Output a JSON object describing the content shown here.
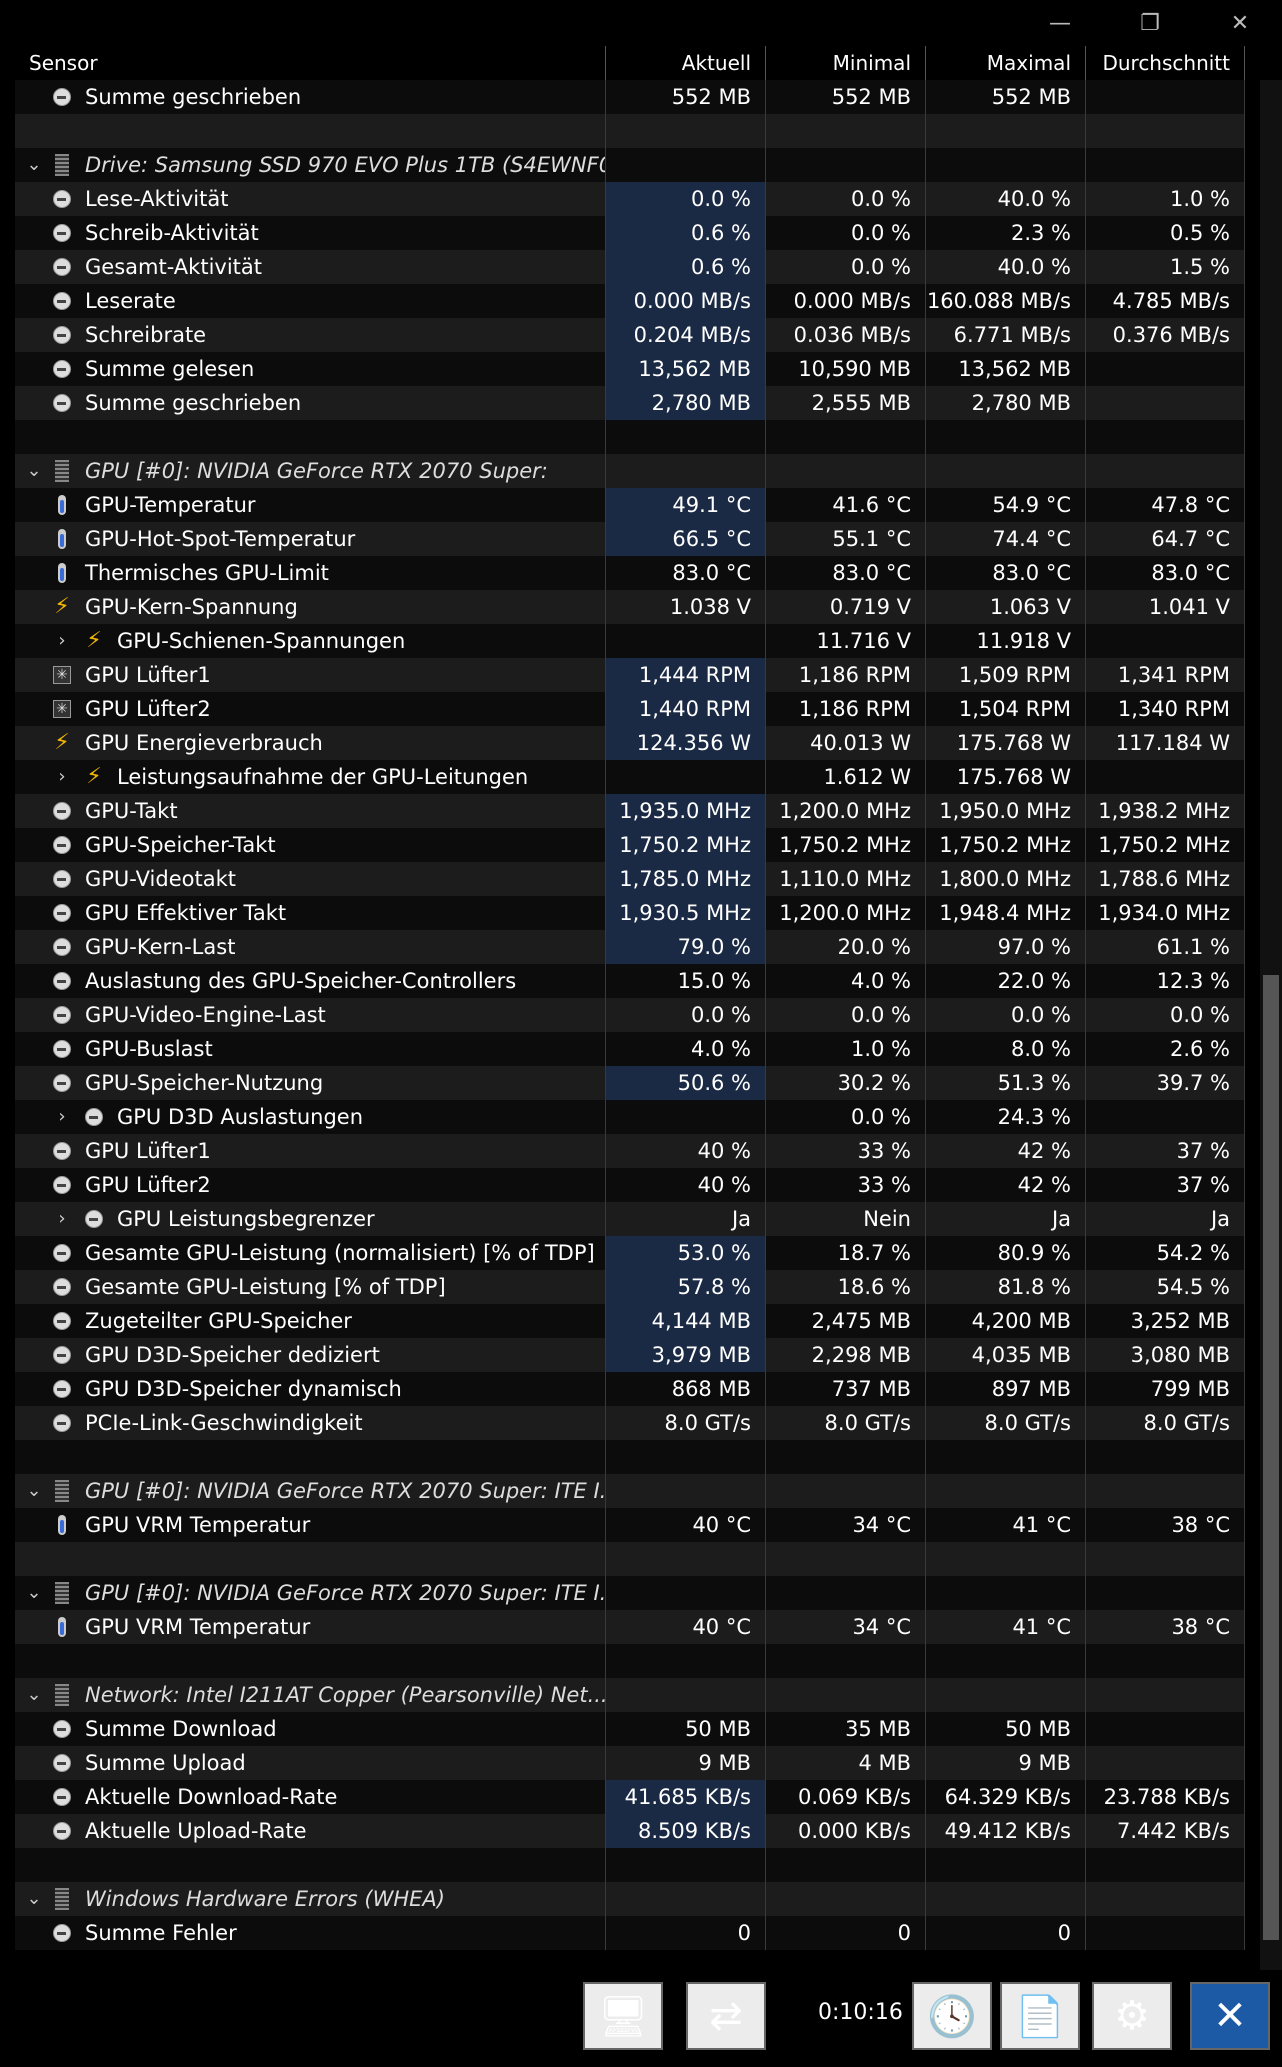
{
  "window": {
    "minimize_glyph": "—",
    "restore_glyph": "❐",
    "close_glyph": "✕"
  },
  "columns": {
    "sensor": "Sensor",
    "current": "Aktuell",
    "min": "Minimal",
    "max": "Maximal",
    "avg": "Durchschnitt"
  },
  "rows": [
    {
      "type": "item",
      "icon": "clock-icon",
      "label": "Summe geschrieben",
      "v": [
        "552 MB",
        "552 MB",
        "552 MB",
        ""
      ],
      "hl": false
    },
    {
      "type": "blank"
    },
    {
      "type": "group",
      "label": "Drive: Samsung SSD 970 EVO Plus 1TB (S4EWNF0..."
    },
    {
      "type": "item",
      "icon": "clock-icon",
      "label": "Lese-Aktivität",
      "v": [
        "0.0 %",
        "0.0 %",
        "40.0 %",
        "1.0 %"
      ],
      "hl": true
    },
    {
      "type": "item",
      "icon": "clock-icon",
      "label": "Schreib-Aktivität",
      "v": [
        "0.6 %",
        "0.0 %",
        "2.3 %",
        "0.5 %"
      ],
      "hl": true
    },
    {
      "type": "item",
      "icon": "clock-icon",
      "label": "Gesamt-Aktivität",
      "v": [
        "0.6 %",
        "0.0 %",
        "40.0 %",
        "1.5 %"
      ],
      "hl": true
    },
    {
      "type": "item",
      "icon": "clock-icon",
      "label": "Leserate",
      "v": [
        "0.000 MB/s",
        "0.000 MB/s",
        "160.088 MB/s",
        "4.785 MB/s"
      ],
      "hl": true
    },
    {
      "type": "item",
      "icon": "clock-icon",
      "label": "Schreibrate",
      "v": [
        "0.204 MB/s",
        "0.036 MB/s",
        "6.771 MB/s",
        "0.376 MB/s"
      ],
      "hl": true
    },
    {
      "type": "item",
      "icon": "clock-icon",
      "label": "Summe gelesen",
      "v": [
        "13,562 MB",
        "10,590 MB",
        "13,562 MB",
        ""
      ],
      "hl": true
    },
    {
      "type": "item",
      "icon": "clock-icon",
      "label": "Summe geschrieben",
      "v": [
        "2,780 MB",
        "2,555 MB",
        "2,780 MB",
        ""
      ],
      "hl": true
    },
    {
      "type": "blank"
    },
    {
      "type": "group",
      "label": "GPU [#0]: NVIDIA GeForce RTX 2070 Super:"
    },
    {
      "type": "item",
      "icon": "thermometer-icon",
      "label": "GPU-Temperatur",
      "v": [
        "49.1 °C",
        "41.6 °C",
        "54.9 °C",
        "47.8 °C"
      ],
      "hl": true
    },
    {
      "type": "item",
      "icon": "thermometer-icon",
      "label": "GPU-Hot-Spot-Temperatur",
      "v": [
        "66.5 °C",
        "55.1 °C",
        "74.4 °C",
        "64.7 °C"
      ],
      "hl": true
    },
    {
      "type": "item",
      "icon": "thermometer-icon",
      "label": "Thermisches GPU-Limit",
      "v": [
        "83.0 °C",
        "83.0 °C",
        "83.0 °C",
        "83.0 °C"
      ],
      "hl": false
    },
    {
      "type": "item",
      "icon": "voltage-icon",
      "label": "GPU-Kern-Spannung",
      "v": [
        "1.038 V",
        "0.719 V",
        "1.063 V",
        "1.041 V"
      ],
      "hl": false
    },
    {
      "type": "item",
      "icon": "voltage-icon",
      "label": "GPU-Schienen-Spannungen",
      "v": [
        "",
        "11.716 V",
        "11.918 V",
        ""
      ],
      "hl": false,
      "sub": true
    },
    {
      "type": "item",
      "icon": "fan-icon",
      "label": "GPU Lüfter1",
      "v": [
        "1,444 RPM",
        "1,186 RPM",
        "1,509 RPM",
        "1,341 RPM"
      ],
      "hl": true
    },
    {
      "type": "item",
      "icon": "fan-icon",
      "label": "GPU Lüfter2",
      "v": [
        "1,440 RPM",
        "1,186 RPM",
        "1,504 RPM",
        "1,340 RPM"
      ],
      "hl": true
    },
    {
      "type": "item",
      "icon": "voltage-icon",
      "label": "GPU Energieverbrauch",
      "v": [
        "124.356 W",
        "40.013 W",
        "175.768 W",
        "117.184 W"
      ],
      "hl": true
    },
    {
      "type": "item",
      "icon": "voltage-icon",
      "label": "Leistungsaufnahme der GPU-Leitungen",
      "v": [
        "",
        "1.612 W",
        "175.768 W",
        ""
      ],
      "hl": false,
      "sub": true
    },
    {
      "type": "item",
      "icon": "clock-icon",
      "label": "GPU-Takt",
      "v": [
        "1,935.0 MHz",
        "1,200.0 MHz",
        "1,950.0 MHz",
        "1,938.2 MHz"
      ],
      "hl": true
    },
    {
      "type": "item",
      "icon": "clock-icon",
      "label": "GPU-Speicher-Takt",
      "v": [
        "1,750.2 MHz",
        "1,750.2 MHz",
        "1,750.2 MHz",
        "1,750.2 MHz"
      ],
      "hl": true
    },
    {
      "type": "item",
      "icon": "clock-icon",
      "label": "GPU-Videotakt",
      "v": [
        "1,785.0 MHz",
        "1,110.0 MHz",
        "1,800.0 MHz",
        "1,788.6 MHz"
      ],
      "hl": true
    },
    {
      "type": "item",
      "icon": "clock-icon",
      "label": "GPU Effektiver Takt",
      "v": [
        "1,930.5 MHz",
        "1,200.0 MHz",
        "1,948.4 MHz",
        "1,934.0 MHz"
      ],
      "hl": true
    },
    {
      "type": "item",
      "icon": "clock-icon",
      "label": "GPU-Kern-Last",
      "v": [
        "79.0 %",
        "20.0 %",
        "97.0 %",
        "61.1 %"
      ],
      "hl": true
    },
    {
      "type": "item",
      "icon": "clock-icon",
      "label": "Auslastung des GPU-Speicher-Controllers",
      "v": [
        "15.0 %",
        "4.0 %",
        "22.0 %",
        "12.3 %"
      ],
      "hl": false
    },
    {
      "type": "item",
      "icon": "clock-icon",
      "label": "GPU-Video-Engine-Last",
      "v": [
        "0.0 %",
        "0.0 %",
        "0.0 %",
        "0.0 %"
      ],
      "hl": false
    },
    {
      "type": "item",
      "icon": "clock-icon",
      "label": "GPU-Buslast",
      "v": [
        "4.0 %",
        "1.0 %",
        "8.0 %",
        "2.6 %"
      ],
      "hl": false
    },
    {
      "type": "item",
      "icon": "clock-icon",
      "label": "GPU-Speicher-Nutzung",
      "v": [
        "50.6 %",
        "30.2 %",
        "51.3 %",
        "39.7 %"
      ],
      "hl": true
    },
    {
      "type": "item",
      "icon": "clock-icon",
      "label": "GPU D3D Auslastungen",
      "v": [
        "",
        "0.0 %",
        "24.3 %",
        ""
      ],
      "hl": false,
      "sub": true
    },
    {
      "type": "item",
      "icon": "clock-icon",
      "label": "GPU Lüfter1",
      "v": [
        "40 %",
        "33 %",
        "42 %",
        "37 %"
      ],
      "hl": false
    },
    {
      "type": "item",
      "icon": "clock-icon",
      "label": "GPU Lüfter2",
      "v": [
        "40 %",
        "33 %",
        "42 %",
        "37 %"
      ],
      "hl": false
    },
    {
      "type": "item",
      "icon": "clock-icon",
      "label": "GPU Leistungsbegrenzer",
      "v": [
        "Ja",
        "Nein",
        "Ja",
        "Ja"
      ],
      "hl": false,
      "sub": true
    },
    {
      "type": "item",
      "icon": "clock-icon",
      "label": "Gesamte GPU-Leistung (normalisiert) [% of TDP]",
      "v": [
        "53.0 %",
        "18.7 %",
        "80.9 %",
        "54.2 %"
      ],
      "hl": true
    },
    {
      "type": "item",
      "icon": "clock-icon",
      "label": "Gesamte GPU-Leistung [% of TDP]",
      "v": [
        "57.8 %",
        "18.6 %",
        "81.8 %",
        "54.5 %"
      ],
      "hl": true
    },
    {
      "type": "item",
      "icon": "clock-icon",
      "label": "Zugeteilter GPU-Speicher",
      "v": [
        "4,144 MB",
        "2,475 MB",
        "4,200 MB",
        "3,252 MB"
      ],
      "hl": true
    },
    {
      "type": "item",
      "icon": "clock-icon",
      "label": "GPU D3D-Speicher dediziert",
      "v": [
        "3,979 MB",
        "2,298 MB",
        "4,035 MB",
        "3,080 MB"
      ],
      "hl": true
    },
    {
      "type": "item",
      "icon": "clock-icon",
      "label": "GPU D3D-Speicher dynamisch",
      "v": [
        "868 MB",
        "737 MB",
        "897 MB",
        "799 MB"
      ],
      "hl": false
    },
    {
      "type": "item",
      "icon": "clock-icon",
      "label": "PCIe-Link-Geschwindigkeit",
      "v": [
        "8.0 GT/s",
        "8.0 GT/s",
        "8.0 GT/s",
        "8.0 GT/s"
      ],
      "hl": false
    },
    {
      "type": "blank"
    },
    {
      "type": "group",
      "label": "GPU [#0]: NVIDIA GeForce RTX 2070 Super: ITE I..."
    },
    {
      "type": "item",
      "icon": "thermometer-icon",
      "label": "GPU VRM Temperatur",
      "v": [
        "40 °C",
        "34 °C",
        "41 °C",
        "38 °C"
      ],
      "hl": false
    },
    {
      "type": "blank"
    },
    {
      "type": "group",
      "label": "GPU [#0]: NVIDIA GeForce RTX 2070 Super: ITE I..."
    },
    {
      "type": "item",
      "icon": "thermometer-icon",
      "label": "GPU VRM Temperatur",
      "v": [
        "40 °C",
        "34 °C",
        "41 °C",
        "38 °C"
      ],
      "hl": false
    },
    {
      "type": "blank"
    },
    {
      "type": "group",
      "label": "Network: Intel I211AT Copper (Pearsonville) Net..."
    },
    {
      "type": "item",
      "icon": "clock-icon",
      "label": "Summe Download",
      "v": [
        "50 MB",
        "35 MB",
        "50 MB",
        ""
      ],
      "hl": false
    },
    {
      "type": "item",
      "icon": "clock-icon",
      "label": "Summe Upload",
      "v": [
        "9 MB",
        "4 MB",
        "9 MB",
        ""
      ],
      "hl": false
    },
    {
      "type": "item",
      "icon": "clock-icon",
      "label": "Aktuelle Download-Rate",
      "v": [
        "41.685 KB/s",
        "0.069 KB/s",
        "64.329 KB/s",
        "23.788 KB/s"
      ],
      "hl": true
    },
    {
      "type": "item",
      "icon": "clock-icon",
      "label": "Aktuelle Upload-Rate",
      "v": [
        "8.509 KB/s",
        "0.000 KB/s",
        "49.412 KB/s",
        "7.442 KB/s"
      ],
      "hl": true
    },
    {
      "type": "blank"
    },
    {
      "type": "group",
      "label": "Windows Hardware Errors (WHEA)"
    },
    {
      "type": "item",
      "icon": "clock-icon",
      "label": "Summe Fehler",
      "v": [
        "0",
        "0",
        "0",
        ""
      ],
      "hl": false
    }
  ],
  "footer": {
    "timer": "0:10:16",
    "buttons": [
      "network-monitor-icon",
      "compare-icon",
      "clock-icon",
      "report-icon",
      "settings-icon",
      "close-icon"
    ]
  }
}
